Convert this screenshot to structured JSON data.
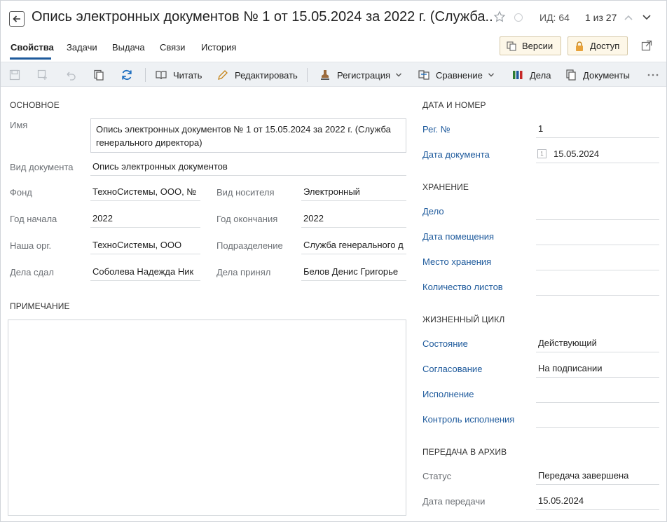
{
  "header": {
    "title": "Опись электронных документов № 1 от 15.05.2024 за 2022 г. (Служба...",
    "id_label": "ИД: 64",
    "position": "1 из 27",
    "versions_label": "Версии",
    "access_label": "Доступ"
  },
  "tabs": [
    "Свойства",
    "Задачи",
    "Выдача",
    "Связи",
    "История"
  ],
  "toolbar": {
    "read": "Читать",
    "edit": "Редактировать",
    "registration": "Регистрация",
    "compare": "Сравнение",
    "cases": "Дела",
    "documents": "Документы"
  },
  "main": {
    "section_title": "ОСНОВНОЕ",
    "name_label": "Имя",
    "name_value": "Опись электронных документов № 1 от 15.05.2024 за 2022 г. (Служба генерального директора)",
    "doc_kind_label": "Вид документа",
    "doc_kind_value": "Опись электронных документов",
    "fund_label": "Фонд",
    "fund_value": "ТехноСистемы, ООО, №",
    "carrier_label": "Вид носителя",
    "carrier_value": "Электронный",
    "start_year_label": "Год начала",
    "start_year_value": "2022",
    "end_year_label": "Год окончания",
    "end_year_value": "2022",
    "org_label": "Наша орг.",
    "org_value": "ТехноСистемы, ООО",
    "dept_label": "Подразделение",
    "dept_value": "Служба генерального д",
    "handed_label": "Дела сдал",
    "handed_value": "Соболева Надежда Ник",
    "received_label": "Дела принял",
    "received_value": "Белов Денис Григорье",
    "note_title": "ПРИМЕЧАНИЕ"
  },
  "right": {
    "date_number_title": "ДАТА И НОМЕР",
    "reg_no_label": "Рег. №",
    "reg_no_value": "1",
    "doc_date_label": "Дата документа",
    "doc_date_value": "15.05.2024",
    "calendar_glyph": "1",
    "storage_title": "ХРАНЕНИЕ",
    "case_label": "Дело",
    "placement_date_label": "Дата помещения",
    "location_label": "Место хранения",
    "sheets_label": "Количество листов",
    "lifecycle_title": "ЖИЗНЕННЫЙ ЦИКЛ",
    "state_label": "Состояние",
    "state_value": "Действующий",
    "approval_label": "Согласование",
    "approval_value": "На подписании",
    "execution_label": "Исполнение",
    "control_label": "Контроль исполнения",
    "archive_title": "ПЕРЕДАЧА В АРХИВ",
    "status_label": "Статус",
    "status_value": "Передача завершена",
    "transfer_date_label": "Дата передачи",
    "transfer_date_value": "15.05.2024"
  },
  "colors": {
    "accent": "#1e5a9c",
    "toolbar_bg": "#eef1f4",
    "button_bg": "#fdf7e8"
  }
}
